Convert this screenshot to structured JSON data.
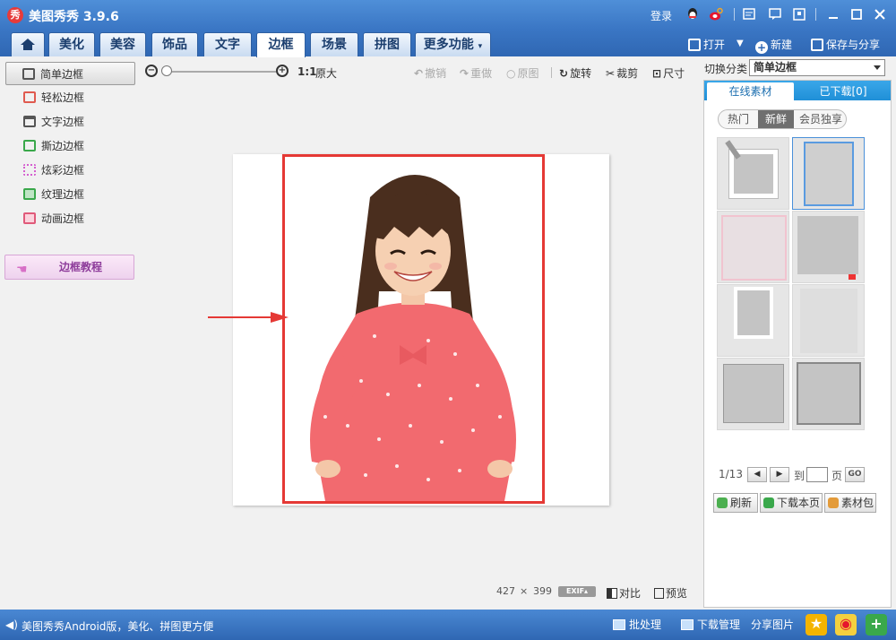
{
  "window": {
    "logo_char": "秀",
    "title": "美图秀秀 3.9.6",
    "login": "登录"
  },
  "tabs": {
    "items": [
      "美化",
      "美容",
      "饰品",
      "文字",
      "边框",
      "场景",
      "拼图"
    ],
    "active": "边框",
    "more": "更多功能",
    "more_caret": "▾"
  },
  "top_actions": {
    "open": "打开",
    "open_caret": "▼",
    "new": "新建",
    "save_share": "保存与分享"
  },
  "sidebar": {
    "items": [
      {
        "label": "简单边框",
        "active": true,
        "icon": "square-frame-icon",
        "color": "#555555"
      },
      {
        "label": "轻松边框",
        "active": false,
        "icon": "easy-frame-icon",
        "color": "#e05a4f"
      },
      {
        "label": "文字边框",
        "active": false,
        "icon": "text-frame-icon",
        "color": "#555555"
      },
      {
        "label": "撕边边框",
        "active": false,
        "icon": "torn-frame-icon",
        "color": "#3aa84b"
      },
      {
        "label": "炫彩边框",
        "active": false,
        "icon": "colorful-frame-icon",
        "color": "#d45fcf"
      },
      {
        "label": "纹理边框",
        "active": false,
        "icon": "texture-frame-icon",
        "color": "#3aa84b"
      },
      {
        "label": "动画边框",
        "active": false,
        "icon": "animation-frame-icon",
        "color": "#e05a7a"
      }
    ],
    "tutorial": "边框教程",
    "tutorial_hand": "☚"
  },
  "toolbar": {
    "zoom_out_glyph": "−",
    "zoom_in_glyph": "+",
    "ratio": "1:1",
    "original_size": "原大",
    "undo": "撤销",
    "redo": "重做",
    "original": "原图",
    "rotate": "旋转",
    "crop": "裁剪",
    "size": "尺寸",
    "undo_glyph": "↶",
    "redo_glyph": "↷",
    "original_glyph": "○",
    "rotate_glyph": "↻",
    "crop_glyph": "✂",
    "size_glyph": "⊡"
  },
  "canvas": {
    "width": "427",
    "times": "×",
    "height": "399",
    "exif": "EXIF▴",
    "compare": "对比",
    "preview": "预览"
  },
  "right_panel": {
    "switch_label": "切换分类",
    "category": "简单边框",
    "tab_online": "在线素材",
    "tab_downloaded": "已下载[0]",
    "filters": [
      "热门",
      "新鲜",
      "会员独享"
    ],
    "active_filter": "新鲜",
    "page_indicator": "1/13",
    "prev_glyph": "◀",
    "next_glyph": "▶",
    "goto_label": "到",
    "page_label": "页",
    "page_value": "",
    "go": "GO",
    "refresh": "刷新",
    "download_page": "下载本页",
    "material_pack": "素材包"
  },
  "statusbar": {
    "speaker": "◀)",
    "promo": "美图秀秀Android版，美化、拼图更方便",
    "batch": "批处理",
    "download_mgr": "下载管理",
    "share_pic": "分享图片",
    "star_glyph": "★",
    "weibo_glyph": "◉",
    "plus_glyph": "+"
  },
  "colors": {
    "accent_blue": "#2f67b3",
    "frame_red": "#e53935",
    "dress_pink": "#f26a6f"
  }
}
